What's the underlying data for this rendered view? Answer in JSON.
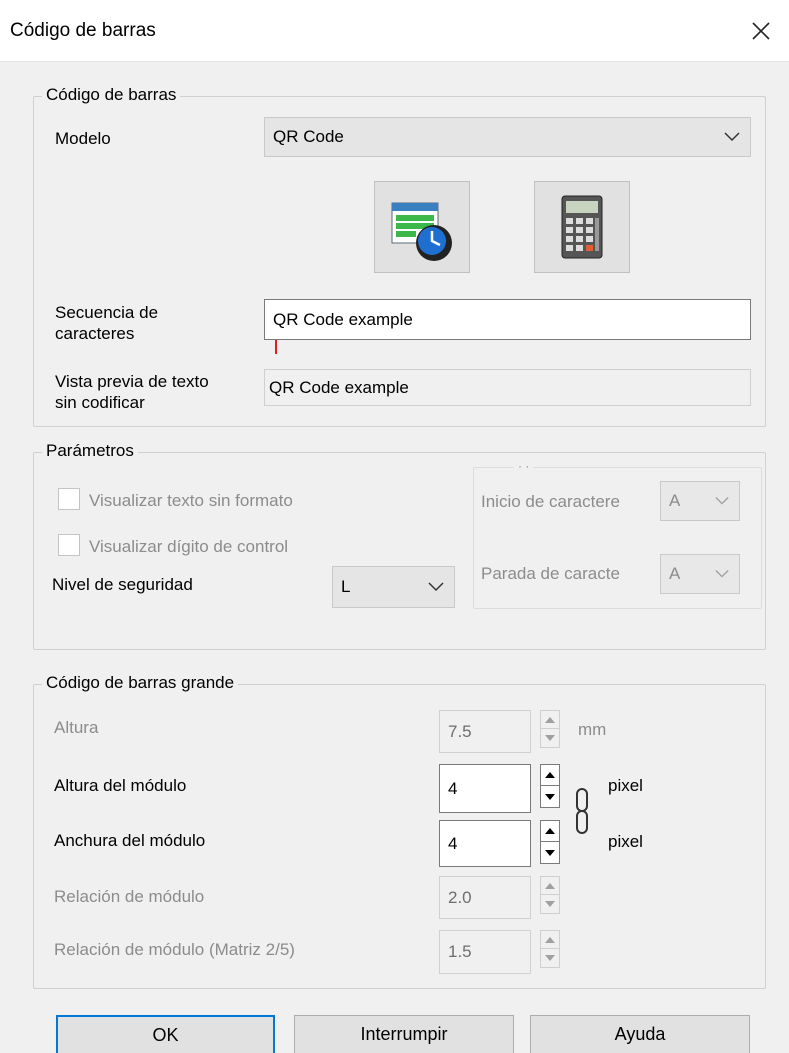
{
  "window": {
    "title": "Código de barras"
  },
  "barcode_group": {
    "title": "Código de barras",
    "model_label": "Modelo",
    "model_value": "QR Code",
    "sequence_label": "Secuencia de\ncaracteres",
    "sequence_value": "QR Code example",
    "preview_label": "Vista previa de texto\nsin codificar",
    "preview_value": "QR Code example"
  },
  "params_group": {
    "title": "Parámetros",
    "show_plain_text_label": "Visualizar texto sin formato",
    "show_plain_text_checked": false,
    "show_check_digit_label": "Visualizar dígito de control",
    "show_check_digit_checked": false,
    "security_level_label": "Nivel de seguridad",
    "security_level_value": "L",
    "start_char_label": "Inicio de caractere",
    "start_char_value": "A",
    "stop_char_label": "Parada de caracte",
    "stop_char_value": "A"
  },
  "large_group": {
    "title": "Código de barras grande",
    "height_label": "Altura",
    "height_value": "7.5",
    "height_unit": "mm",
    "module_height_label": "Altura del módulo",
    "module_height_value": "4",
    "module_height_unit": "pixel",
    "module_width_label": "Anchura del módulo",
    "module_width_value": "4",
    "module_width_unit": "pixel",
    "module_ratio_label": "Relación de módulo",
    "module_ratio_value": "2.0",
    "module_ratio_matrix_label": "Relación de módulo (Matriz 2/5)",
    "module_ratio_matrix_value": "1.5"
  },
  "buttons": {
    "ok": "OK",
    "cancel": "Interrumpir",
    "help": "Ayuda"
  }
}
